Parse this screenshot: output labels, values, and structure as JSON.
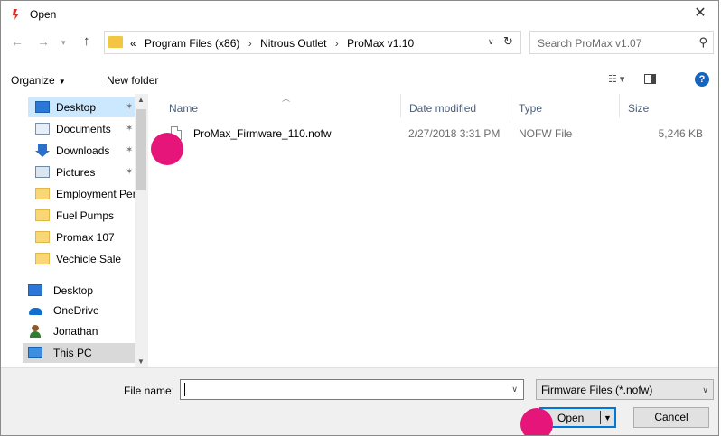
{
  "window": {
    "title": "Open",
    "close_glyph": "✕"
  },
  "address": {
    "crumbs": [
      "«",
      "Program Files (x86)",
      "Nitrous Outlet",
      "ProMax v1.10"
    ],
    "search_placeholder": "Search ProMax v1.07"
  },
  "toolbar": {
    "organize_label": "Organize",
    "new_folder_label": "New folder",
    "help_label": "?"
  },
  "nav": {
    "quick_access": [
      {
        "label": "Desktop",
        "icon": "desktop-icon",
        "pinned": true,
        "selected": true
      },
      {
        "label": "Documents",
        "icon": "documents-icon",
        "pinned": true
      },
      {
        "label": "Downloads",
        "icon": "downloads-icon",
        "pinned": true
      },
      {
        "label": "Pictures",
        "icon": "pictures-icon",
        "pinned": true
      },
      {
        "label": "Employment Per",
        "icon": "folder-icon"
      },
      {
        "label": "Fuel Pumps",
        "icon": "folder-icon"
      },
      {
        "label": "Promax 107",
        "icon": "folder-icon"
      },
      {
        "label": "Vechicle Sale",
        "icon": "folder-icon"
      }
    ],
    "locations": [
      {
        "label": "Desktop",
        "icon": "desktop-icon"
      },
      {
        "label": "OneDrive",
        "icon": "onedrive-icon"
      },
      {
        "label": "Jonathan",
        "icon": "user-icon"
      },
      {
        "label": "This PC",
        "icon": "this-pc-icon",
        "selected": true
      }
    ]
  },
  "filelist": {
    "columns": {
      "name": "Name",
      "date": "Date modified",
      "type": "Type",
      "size": "Size"
    },
    "rows": [
      {
        "name": "ProMax_Firmware_110.nofw",
        "date": "2/27/2018 3:31 PM",
        "type": "NOFW File",
        "size": "5,246 KB"
      }
    ]
  },
  "footer": {
    "filename_label": "File name:",
    "filename_value": "",
    "filter_value": "Firmware Files (*.nofw)",
    "open_label": "Open",
    "cancel_label": "Cancel"
  },
  "colors": {
    "marker": "#e6157a",
    "selection": "#cce8ff",
    "accent": "#0078d7"
  }
}
